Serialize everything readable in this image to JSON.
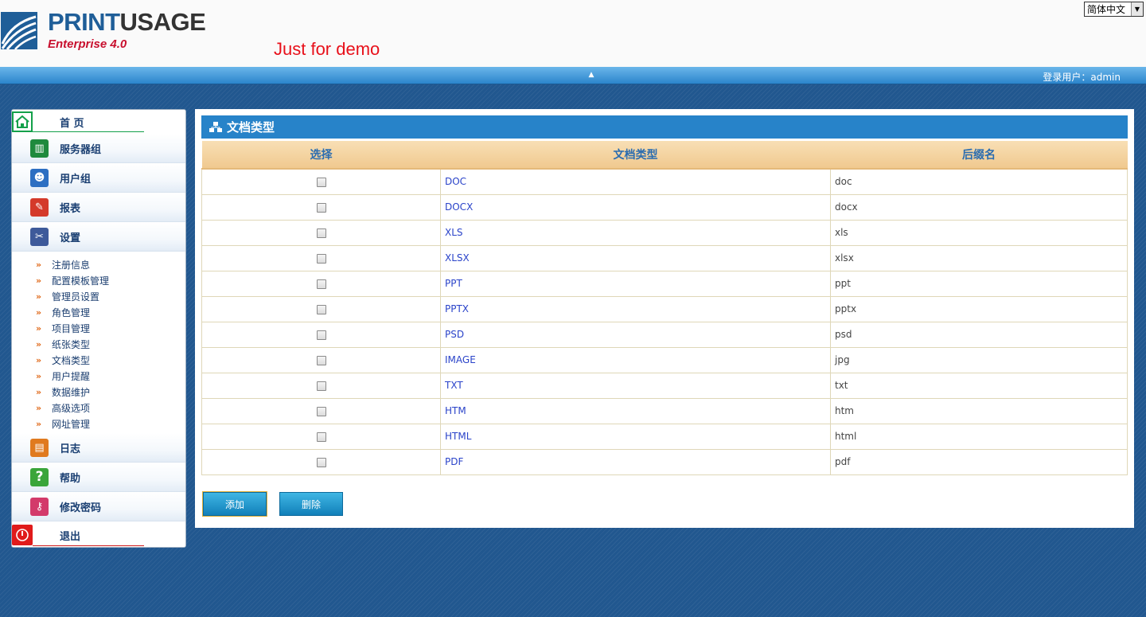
{
  "header": {
    "logo_main_a": "PRINT",
    "logo_main_b": "USAGE",
    "logo_sub": "Enterprise 4.0",
    "demo_text": "Just for demo",
    "language": "简体中文"
  },
  "topbar": {
    "login_label": "登录用户：",
    "username": "admin"
  },
  "sidebar": {
    "items": [
      {
        "label": "首  页"
      },
      {
        "label": "服务器组"
      },
      {
        "label": "用户组"
      },
      {
        "label": "报表"
      },
      {
        "label": "设置"
      },
      {
        "label": "日志"
      },
      {
        "label": "帮助"
      },
      {
        "label": "修改密码"
      },
      {
        "label": "退出"
      }
    ],
    "settings_sub": [
      {
        "label": "注册信息"
      },
      {
        "label": "配置模板管理"
      },
      {
        "label": "管理员设置"
      },
      {
        "label": "角色管理"
      },
      {
        "label": "项目管理"
      },
      {
        "label": "纸张类型"
      },
      {
        "label": "文档类型"
      },
      {
        "label": "用户提醒"
      },
      {
        "label": "数据维护"
      },
      {
        "label": "高级选项"
      },
      {
        "label": "网址管理"
      }
    ]
  },
  "main": {
    "title": "文档类型",
    "columns": [
      "选择",
      "文档类型",
      "后缀名"
    ],
    "rows": [
      {
        "type": "DOC",
        "ext": "doc"
      },
      {
        "type": "DOCX",
        "ext": "docx"
      },
      {
        "type": "XLS",
        "ext": "xls"
      },
      {
        "type": "XLSX",
        "ext": "xlsx"
      },
      {
        "type": "PPT",
        "ext": "ppt"
      },
      {
        "type": "PPTX",
        "ext": "pptx"
      },
      {
        "type": "PSD",
        "ext": "psd"
      },
      {
        "type": "IMAGE",
        "ext": "jpg"
      },
      {
        "type": "TXT",
        "ext": "txt"
      },
      {
        "type": "HTM",
        "ext": "htm"
      },
      {
        "type": "HTML",
        "ext": "html"
      },
      {
        "type": "PDF",
        "ext": "pdf"
      }
    ],
    "add_label": "添加",
    "delete_label": "删除"
  },
  "colors": {
    "accent_blue": "#2783c9",
    "header_tan": "#f0c98f",
    "link_blue": "#2a43c9",
    "demo_red": "#e8101a"
  }
}
